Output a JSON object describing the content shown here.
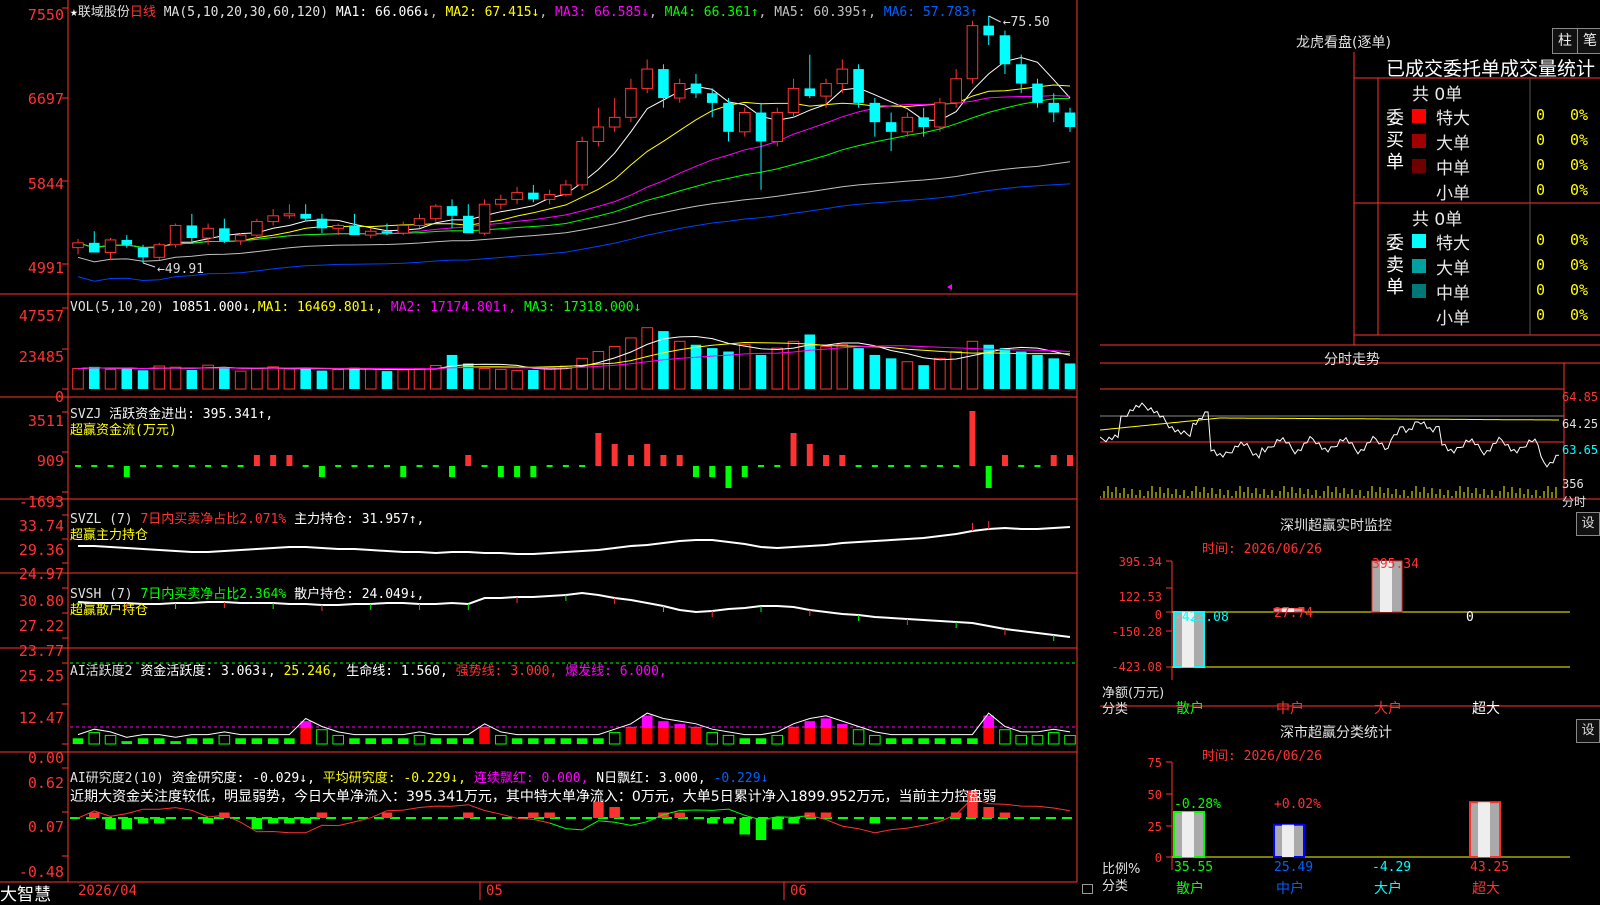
{
  "app": {
    "brand": "大智慧",
    "corner_icon": "lock-icon"
  },
  "colors": {
    "up": "#ff3232",
    "down": "#00ffff",
    "ma1": "#ffffff",
    "ma2": "#ffff00",
    "ma3": "#ff00ff",
    "ma4": "#00ff00",
    "ma5": "#c0c0c0",
    "ma6": "#0040ff",
    "axis": "#ff3232",
    "text_yellow": "#ffff00",
    "text_red": "#ff3232",
    "text_green": "#00ff00",
    "text_magenta": "#ff00ff",
    "text_blue": "#0060ff"
  },
  "kline_header": {
    "star": "★",
    "stock": "联域股份",
    "period": "日线",
    "ma_def": "MA(5,10,20,30,60,120)",
    "ma1": "MA1: 66.066↓",
    "ma2": "MA2: 67.415↓",
    "ma3": "MA3: 66.585↓",
    "ma4": "MA4: 66.361↑",
    "ma5": "MA5: 60.395↑,",
    "ma6": "MA6: 57.783↑"
  },
  "kline_axis": [
    "7550",
    "6697",
    "5844",
    "4991"
  ],
  "kline_annot": {
    "high": "75.50",
    "low": "49.91"
  },
  "vol_header": {
    "def": "VOL(5,10,20)",
    "v": "10851.000↓,",
    "ma1": "MA1: 16469.801↓,",
    "ma2": "MA2: 17174.801↑,",
    "ma3": "MA3: 17318.000↓"
  },
  "vol_axis": [
    "47557",
    "23485",
    "0"
  ],
  "svzj_header": {
    "name": "SVZJ",
    "label": "活跃资金进出: 395.341↑,",
    "sub": "超赢资金流(万元)"
  },
  "svzj_axis": [
    "3511",
    "909",
    "-1693"
  ],
  "svzl_header": {
    "name": "SVZL (7)",
    "ratio": "7日内买卖净占比2.071%",
    "hold": "主力持仓: 31.957↑,",
    "sub": "超赢主力持仓"
  },
  "svzl_axis": [
    "33.74",
    "29.36",
    "24.97"
  ],
  "svsh_header": {
    "name": "SVSH (7)",
    "ratio": "7日内买卖净占比2.364%",
    "hold": "散户持仓: 24.049↓,",
    "sub": "超赢散户持仓"
  },
  "svsh_axis": [
    "30.80",
    "27.22",
    "23.77"
  ],
  "ai1_header": {
    "name": "AI活跃度2",
    "active": "资金活跃度: 3.063↓,",
    "v2": "25.246,",
    "life": "生命线: 1.560,",
    "strong": "强势线: 3.000,",
    "burst": "爆发线: 6.000,"
  },
  "ai1_axis": [
    "25.25",
    "12.47",
    "0.00"
  ],
  "ai2_header": {
    "name": "AI研究度2(10)",
    "research": "资金研究度: -0.029↓,",
    "avg": "平均研究度: -0.229↓,",
    "red": "连续飘红: 0.000,",
    "nred": "N日飘红: 3.000,",
    "last": "-0.229↓"
  },
  "ai2_comment": "近期大资金关注度较低，明显弱势，今日大单净流入：395.341万元，其中特大单净流入：0万元，大单5日累计净入1899.952万元，当前主力控盘弱",
  "ai2_axis": [
    "0.62",
    "0.07",
    "-0.48"
  ],
  "date_axis": {
    "d1": "2026/04",
    "d2": "05",
    "d3": "06"
  },
  "dragon": {
    "title": "龙虎看盘(逐单)",
    "btn1": "柱",
    "btn2": "笔",
    "subtitle": "已成交委托单成交量统计",
    "buy_label": "委买单",
    "sell_label": "委卖单",
    "buy_total": "共 0单",
    "sell_total": "共 0单",
    "buy_rows": [
      {
        "label": "特大",
        "val": "0",
        "pct": "0%",
        "color": "#ff0000"
      },
      {
        "label": "大单",
        "val": "0",
        "pct": "0%",
        "color": "#a00000"
      },
      {
        "label": "中单",
        "val": "0",
        "pct": "0%",
        "color": "#700000"
      },
      {
        "label": "小单",
        "val": "0",
        "pct": "0%",
        "color": ""
      }
    ],
    "sell_rows": [
      {
        "label": "特大",
        "val": "0",
        "pct": "0%",
        "color": "#00ffff"
      },
      {
        "label": "大单",
        "val": "0",
        "pct": "0%",
        "color": "#00a0a0"
      },
      {
        "label": "中单",
        "val": "0",
        "pct": "0%",
        "color": "#007878"
      },
      {
        "label": "小单",
        "val": "0",
        "pct": "0%",
        "color": ""
      }
    ]
  },
  "intraday": {
    "title": "分时走势",
    "axis": [
      "64.85",
      "64.25",
      "63.65"
    ],
    "vol_label": "356",
    "vol_unit": "分时"
  },
  "sz_monitor": {
    "title": "深圳超赢实时监控",
    "set": "设",
    "time": "时间: 2026/06/26",
    "axis": [
      "395.34",
      "122.53",
      "0",
      "-150.28",
      "-423.08"
    ],
    "ylabel": "净额(万元)",
    "xlabel": "分类",
    "categories": [
      "散户",
      "中户",
      "大户",
      "超大"
    ],
    "values": [
      -423.08,
      27.74,
      395.34,
      0
    ],
    "value_labels": [
      "-423.08",
      "27.74",
      "395.34",
      "0"
    ]
  },
  "sz_stats": {
    "title": "深市超赢分类统计",
    "set": "设",
    "time": "时间: 2026/06/26",
    "axis": [
      "75",
      "50",
      "25",
      "0"
    ],
    "ylabel": "比例%",
    "xlabel": "分类",
    "categories": [
      "散户",
      "中户",
      "大户",
      "超大"
    ],
    "pct_labels": [
      "-0.28%",
      "+0.02%",
      "",
      ""
    ],
    "values": [
      35.55,
      25.49,
      -4.29,
      43.25
    ],
    "value_labels": [
      "35.55",
      "25.49",
      "-4.29",
      "43.25"
    ]
  },
  "chart_data": {
    "type": "bar",
    "title": "深圳超赢实时监控",
    "categories": [
      "散户",
      "中户",
      "大户",
      "超大"
    ],
    "series": [
      {
        "name": "净额(万元)",
        "values": [
          -423.08,
          27.74,
          395.34,
          0
        ]
      },
      {
        "name": "比例%",
        "values": [
          35.55,
          25.49,
          -4.29,
          43.25
        ]
      }
    ],
    "ylabel": "净额(万元)",
    "xlabel": "分类",
    "ylim": [
      -423.08,
      395.34
    ],
    "kline": {
      "type": "candlestick",
      "ylim": [
        49.91,
        75.5
      ],
      "ohlc": [
        [
          51.5,
          52.4,
          50.8,
          52.0
        ],
        [
          52.0,
          53.2,
          51.2,
          51.0
        ],
        [
          51.0,
          52.5,
          50.2,
          52.3
        ],
        [
          52.3,
          52.8,
          51.5,
          51.8
        ],
        [
          51.5,
          51.8,
          49.91,
          50.5
        ],
        [
          50.5,
          52.0,
          50.2,
          51.8
        ],
        [
          51.8,
          54.0,
          51.5,
          53.8
        ],
        [
          53.8,
          55.0,
          52.0,
          52.5
        ],
        [
          52.5,
          54.0,
          51.8,
          53.5
        ],
        [
          53.5,
          54.5,
          52.0,
          52.2
        ],
        [
          52.2,
          53.0,
          51.8,
          52.8
        ],
        [
          52.8,
          54.5,
          52.5,
          54.2
        ],
        [
          54.2,
          55.5,
          53.8,
          54.8
        ],
        [
          54.8,
          56.0,
          54.5,
          55.0
        ],
        [
          55.0,
          56.0,
          54.2,
          54.5
        ],
        [
          54.5,
          55.0,
          53.0,
          53.5
        ],
        [
          53.5,
          54.0,
          52.8,
          53.8
        ],
        [
          53.8,
          55.0,
          53.0,
          52.8
        ],
        [
          52.8,
          53.5,
          52.5,
          53.2
        ],
        [
          53.2,
          54.0,
          52.8,
          53.0
        ],
        [
          53.0,
          54.2,
          52.8,
          53.8
        ],
        [
          53.8,
          55.0,
          53.5,
          54.5
        ],
        [
          54.5,
          56.0,
          54.2,
          55.8
        ],
        [
          55.8,
          56.5,
          53.5,
          54.8
        ],
        [
          54.8,
          56.0,
          54.5,
          53.0
        ],
        [
          53.0,
          56.5,
          52.8,
          56.0
        ],
        [
          56.0,
          57.0,
          55.5,
          56.5
        ],
        [
          56.5,
          57.8,
          56.0,
          57.2
        ],
        [
          57.2,
          58.0,
          56.2,
          56.5
        ],
        [
          56.5,
          57.5,
          56.0,
          57.0
        ],
        [
          57.0,
          58.5,
          56.8,
          58.0
        ],
        [
          58.0,
          63.0,
          57.5,
          62.5
        ],
        [
          62.5,
          66.0,
          62.0,
          64.0
        ],
        [
          64.0,
          67.0,
          63.5,
          65.0
        ],
        [
          65.0,
          69.0,
          64.5,
          68.0
        ],
        [
          68.0,
          71.0,
          67.5,
          70.0
        ],
        [
          70.0,
          70.5,
          66.0,
          67.0
        ],
        [
          67.0,
          69.0,
          66.5,
          68.5
        ],
        [
          68.5,
          69.5,
          67.0,
          67.5
        ],
        [
          67.5,
          68.0,
          65.0,
          66.5
        ],
        [
          66.5,
          67.0,
          62.5,
          63.5
        ],
        [
          63.5,
          66.0,
          63.0,
          65.5
        ],
        [
          65.5,
          66.5,
          57.5,
          62.5
        ],
        [
          62.5,
          66.0,
          62.0,
          65.5
        ],
        [
          65.5,
          69.0,
          65.0,
          68.0
        ],
        [
          68.0,
          71.5,
          67.0,
          67.2
        ],
        [
          67.2,
          69.0,
          66.0,
          68.5
        ],
        [
          68.5,
          71.0,
          67.5,
          70.0
        ],
        [
          70.0,
          70.5,
          66.0,
          66.5
        ],
        [
          66.5,
          67.0,
          63.0,
          64.5
        ],
        [
          64.5,
          65.5,
          61.5,
          63.5
        ],
        [
          63.5,
          65.5,
          63.0,
          65.0
        ],
        [
          65.0,
          66.0,
          63.0,
          64.0
        ],
        [
          64.0,
          67.0,
          63.5,
          66.5
        ],
        [
          66.5,
          70.0,
          66.0,
          69.0
        ],
        [
          69.0,
          75.0,
          68.5,
          74.5
        ],
        [
          74.5,
          75.5,
          72.5,
          73.5
        ],
        [
          73.5,
          74.0,
          69.5,
          70.5
        ],
        [
          70.5,
          71.5,
          67.5,
          68.5
        ],
        [
          68.5,
          69.0,
          66.0,
          66.5
        ],
        [
          66.5,
          67.5,
          64.5,
          65.5
        ],
        [
          65.5,
          66.0,
          63.5,
          64.0
        ]
      ]
    },
    "volume": {
      "ylim": [
        0,
        47557
      ],
      "values": [
        12000,
        13000,
        11500,
        12500,
        11000,
        13500,
        12800,
        11200,
        14000,
        12500,
        10500,
        12000,
        13000,
        11800,
        12200,
        10800,
        11500,
        12500,
        11800,
        10500,
        11200,
        12000,
        13800,
        20000,
        15000,
        12000,
        11500,
        10800,
        11200,
        12800,
        13500,
        18000,
        22000,
        25000,
        30000,
        36000,
        34000,
        28000,
        26000,
        24000,
        22000,
        26000,
        20000,
        24000,
        28000,
        32000,
        25000,
        26000,
        24000,
        20000,
        18000,
        16000,
        14000,
        18000,
        22000,
        28000,
        26000,
        24000,
        22000,
        20000,
        18000,
        15000
      ]
    }
  }
}
